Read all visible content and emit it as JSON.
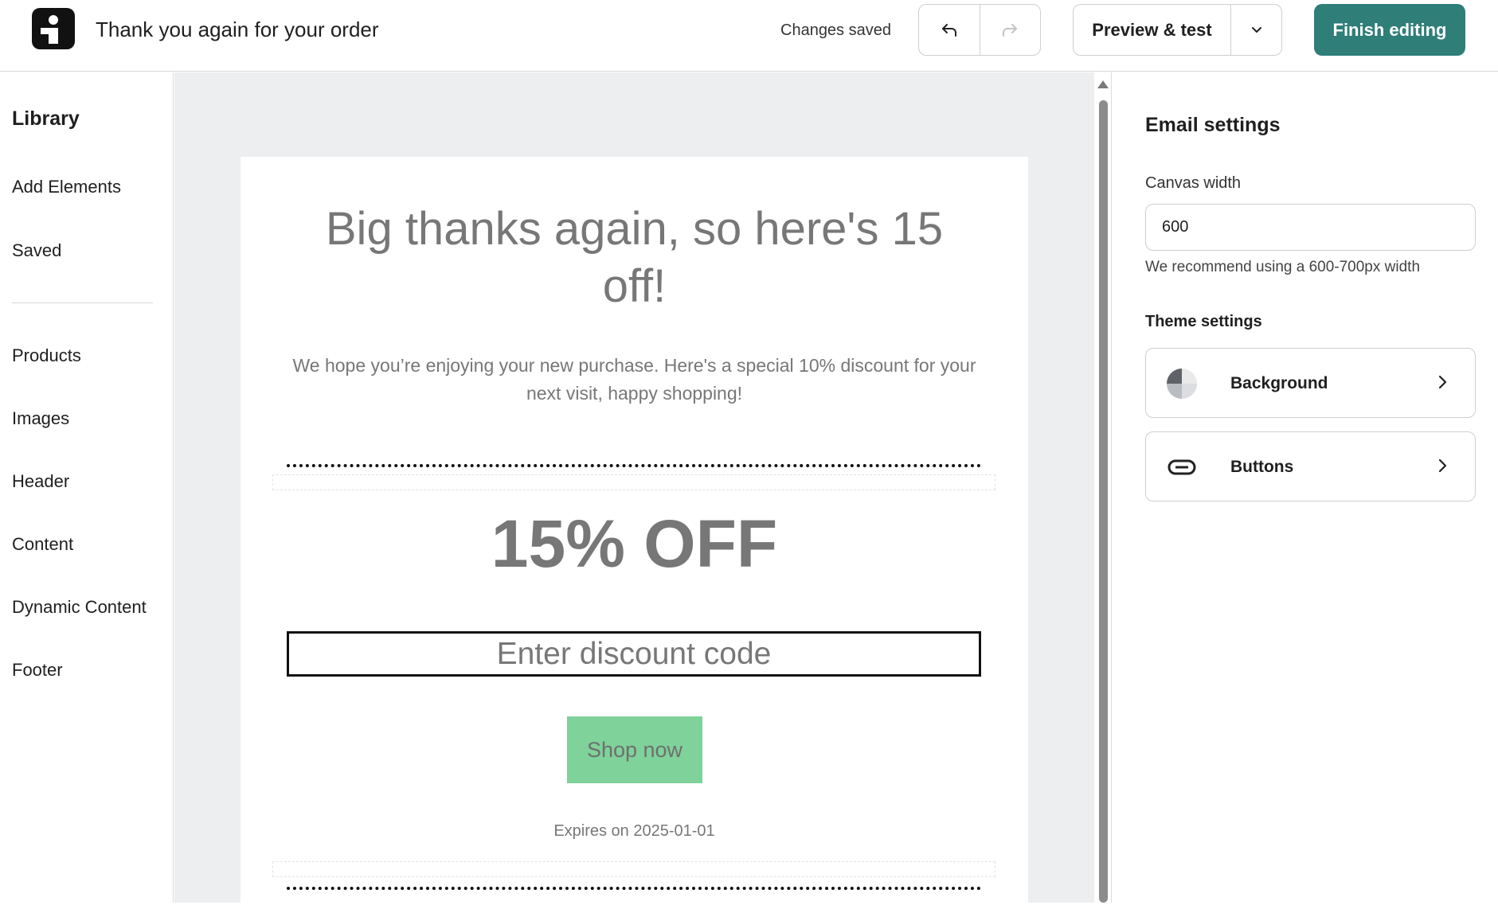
{
  "header": {
    "title": "Thank you again for your order",
    "status": "Changes saved",
    "preview_label": "Preview & test",
    "finish_label": "Finish editing",
    "accent_color": "#2f7e78"
  },
  "sidebar": {
    "title": "Library",
    "primary_items": [
      "Add Elements",
      "Saved"
    ],
    "items": [
      "Products",
      "Images",
      "Header",
      "Content",
      "Dynamic Content",
      "Footer"
    ]
  },
  "email": {
    "headline": "Big thanks again, so here's 15 off!",
    "intro": "We hope you’re enjoying your new purchase. Here's a special 10% discount for your next visit, happy shopping!",
    "offer": "15% OFF",
    "code_placeholder": "Enter discount code",
    "cta_label": "Shop now",
    "cta_color": "#7ed29a",
    "expires": "Expires on 2025-01-01"
  },
  "settings": {
    "title": "Email settings",
    "canvas_width_label": "Canvas width",
    "canvas_width_value": "600",
    "hint": "We recommend using a 600-700px width",
    "theme_label": "Theme settings",
    "theme_items": [
      {
        "label": "Background",
        "icon": "background-pie-icon"
      },
      {
        "label": "Buttons",
        "icon": "button-pill-icon"
      }
    ]
  }
}
